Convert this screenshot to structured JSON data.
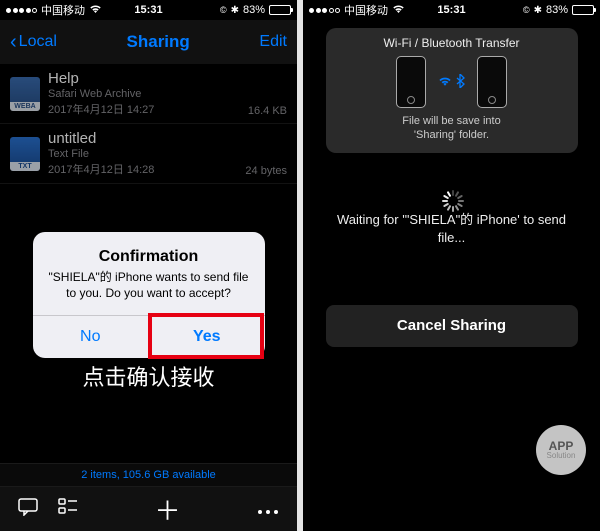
{
  "status": {
    "carrier": "中国移动",
    "time": "15:31",
    "battery_pct": "83%",
    "alarm_glyph": "⏰",
    "bt_glyph": "⚡"
  },
  "left": {
    "nav": {
      "back": "Local",
      "title": "Sharing",
      "edit": "Edit"
    },
    "files": [
      {
        "name": "Help",
        "type": "Safari Web Archive",
        "date": "2017年4月12日 14:27",
        "size": "16.4 KB",
        "badge": "WEBA"
      },
      {
        "name": "untitled",
        "type": "Text File",
        "date": "2017年4月12日 14:28",
        "size": "24 bytes",
        "badge": "TXT"
      }
    ],
    "dialog": {
      "title": "Confirmation",
      "message": "\"SHIELA\"的 iPhone wants to send file to you. Do you want to accept?",
      "no": "No",
      "yes": "Yes"
    },
    "caption": "点击确认接收",
    "summary": "2 items, 105.6 GB available",
    "toolbar_plus": "＋"
  },
  "right": {
    "banner": {
      "title": "Wi-Fi / Bluetooth Transfer",
      "sub1": "File will be save into",
      "sub2": "'Sharing' folder."
    },
    "waiting": "Waiting for '\"SHIELA\"的 iPhone' to send file...",
    "cancel": "Cancel Sharing",
    "badge_top": "APP",
    "badge_sub": "Solution"
  }
}
